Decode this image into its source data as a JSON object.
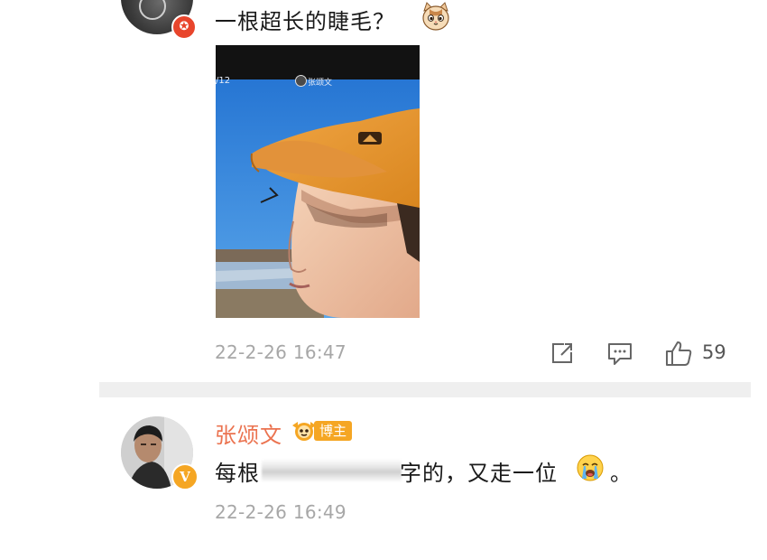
{
  "top_comment": {
    "text": "一根超长的睫毛？",
    "emoji": "cat-face-emoji",
    "badge_icon": "red-star-badge-icon"
  },
  "photo": {
    "counter": "/12",
    "author": "张颂文",
    "subject": "man-in-orange-cap-photo"
  },
  "comment_meta": {
    "timestamp": "22-2-26 16:47",
    "share_icon": "share-icon",
    "comment_icon": "comment-icon",
    "like_icon": "thumbs-up-icon",
    "like_count": "59"
  },
  "reply": {
    "author": "张颂文",
    "blogger_tag": "博主",
    "text_start": "每根",
    "text_end": "字的，又走一位",
    "emoji": "crying-face-emoji",
    "text_period": "。",
    "timestamp": "22-2-26 16:49",
    "badge_icon": "orange-v-badge-icon"
  },
  "colors": {
    "name_accent": "#eb7350",
    "timestamp_gray": "#a7a7a7",
    "divider": "#efefef",
    "vip_badge": "#f5a623",
    "red_badge": "#e8452c"
  }
}
